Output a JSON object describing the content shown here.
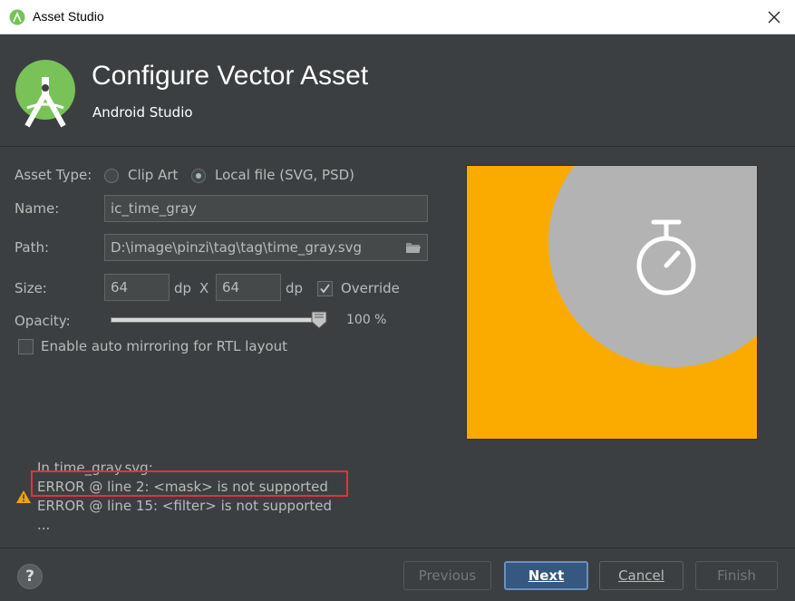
{
  "window": {
    "title": "Asset Studio"
  },
  "header": {
    "title": "Configure Vector Asset",
    "subtitle": "Android Studio"
  },
  "form": {
    "asset_type_label": "Asset Type:",
    "asset_type_options": [
      "Clip Art",
      "Local file (SVG, PSD)"
    ],
    "asset_type_selected": "Local file (SVG, PSD)",
    "name_label": "Name:",
    "name_value": "ic_time_gray",
    "path_label": "Path:",
    "path_value": "D:\\image\\pinzi\\tag\\tag\\time_gray.svg",
    "size_label": "Size:",
    "width_value": "64",
    "height_value": "64",
    "unit": "dp",
    "times": "X",
    "override_label": "Override",
    "override_checked": true,
    "opacity_label": "Opacity:",
    "opacity_value": "100 %",
    "opacity_level": 1.0,
    "rtl_label": "Enable auto mirroring for RTL layout",
    "rtl_checked": false
  },
  "preview": {
    "background_color": "#fbab00",
    "circle_color": "#b3b3b3",
    "icon": "stopwatch-icon"
  },
  "messages": {
    "lines": [
      "In time_gray.svg:",
      "ERROR @ line 2: <mask> is not supported",
      "ERROR @ line 15: <filter> is not supported",
      "..."
    ]
  },
  "footer": {
    "help": "?",
    "previous": "Previous",
    "next": "Next",
    "cancel": "Cancel",
    "finish": "Finish"
  },
  "colors": {
    "accent": "#365880",
    "error_highlight": "#e0333b",
    "warning": "#f0a30a"
  }
}
